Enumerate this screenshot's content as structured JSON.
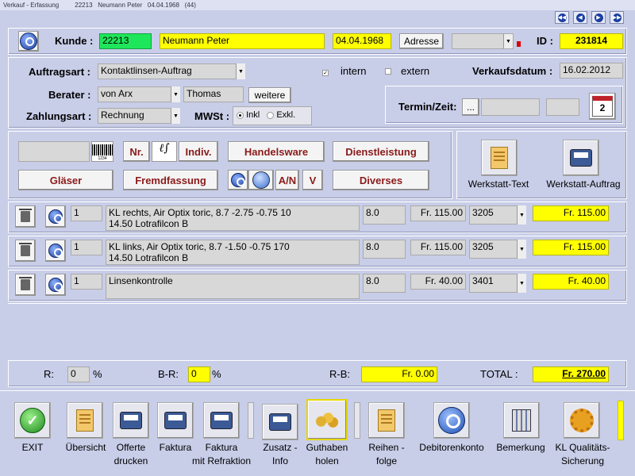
{
  "window": {
    "title": "Verkauf - Erfassung",
    "customer_no": "22213",
    "customer_name": "Neumann Peter",
    "birthdate": "04.04.1968",
    "count": "(44)"
  },
  "header": {
    "kunde_label": "Kunde :",
    "kunde_id": "22213",
    "kunde_name": "Neumann Peter",
    "kunde_date": "04.04.1968",
    "adresse_button": "Adresse",
    "id_label": "ID :",
    "id_value": "231814"
  },
  "order": {
    "auftragsart_label": "Auftragsart :",
    "auftragsart_value": "Kontaktlinsen-Auftrag",
    "intern_label": "intern",
    "intern_checked": true,
    "extern_label": "extern",
    "extern_checked": false,
    "verkaufsdatum_label": "Verkaufsdatum :",
    "verkaufsdatum_value": "16.02.2012",
    "berater_label": "Berater :",
    "berater_value": "von Arx",
    "berater_name": "Thomas",
    "weitere_button": "weitere",
    "zahlungsart_label": "Zahlungsart :",
    "zahlungsart_value": "Rechnung",
    "mwst_label": "MWSt :",
    "inkl_label": "Inkl",
    "exkl_label": "Exkl.",
    "termin_label": "Termin/Zeit:",
    "termin_button": "..."
  },
  "categories": {
    "nr_button": "Nr.",
    "indiv_button": "Indiv.",
    "handelsware_button": "Handelsware",
    "dienstleistung_button": "Dienstleistung",
    "glaeser_button": "Gläser",
    "fremdfassung_button": "Fremdfassung",
    "an_button": "A/N",
    "v_button": "V",
    "diverses_button": "Diverses",
    "werkstatt_text": "Werkstatt-Text",
    "werkstatt_auftrag": "Werkstatt-Auftrag",
    "barcode_digits": "1234"
  },
  "lines": [
    {
      "qty": "1",
      "desc1": "KL rechts, Air Optix toric,   8.7  -2.75  -0.75  10",
      "desc2": "14.50  Lotrafilcon B",
      "vat": "8.0",
      "price": "Fr. 115.00",
      "code": "3205",
      "total": "Fr. 115.00"
    },
    {
      "qty": "1",
      "desc1": "KL links, Air Optix toric,   8.7  -1.50  -0.75  170",
      "desc2": "14.50  Lotrafilcon B",
      "vat": "8.0",
      "price": "Fr. 115.00",
      "code": "3205",
      "total": "Fr. 115.00"
    },
    {
      "qty": "1",
      "desc1": "Linsenkontrolle",
      "desc2": "",
      "vat": "8.0",
      "price": "Fr. 40.00",
      "code": "3401",
      "total": "Fr. 40.00"
    }
  ],
  "totals": {
    "r_label": "R:",
    "r_value": "0",
    "r_unit": "%",
    "br_label": "B-R:",
    "br_value": "0",
    "br_unit": "%",
    "rb_label": "R-B:",
    "rb_value": "Fr. 0.00",
    "total_label": "TOTAL :",
    "total_value": "Fr. 270.00"
  },
  "toolbar": [
    {
      "label": "EXIT"
    },
    {
      "label": "Übersicht"
    },
    {
      "label": "Offerte\ndrucken"
    },
    {
      "label": "Faktura"
    },
    {
      "label": "Faktura\nmit Refraktion"
    },
    {
      "label": "Zusatz -\nInfo"
    },
    {
      "label": "Guthaben\nholen"
    },
    {
      "label": "Reihen -\nfolge"
    },
    {
      "label": "Debitorenkonto"
    },
    {
      "label": "Bemerkung"
    },
    {
      "label": "KL Qualitäts-\nSicherung"
    }
  ],
  "calendar_icon_text": "2"
}
